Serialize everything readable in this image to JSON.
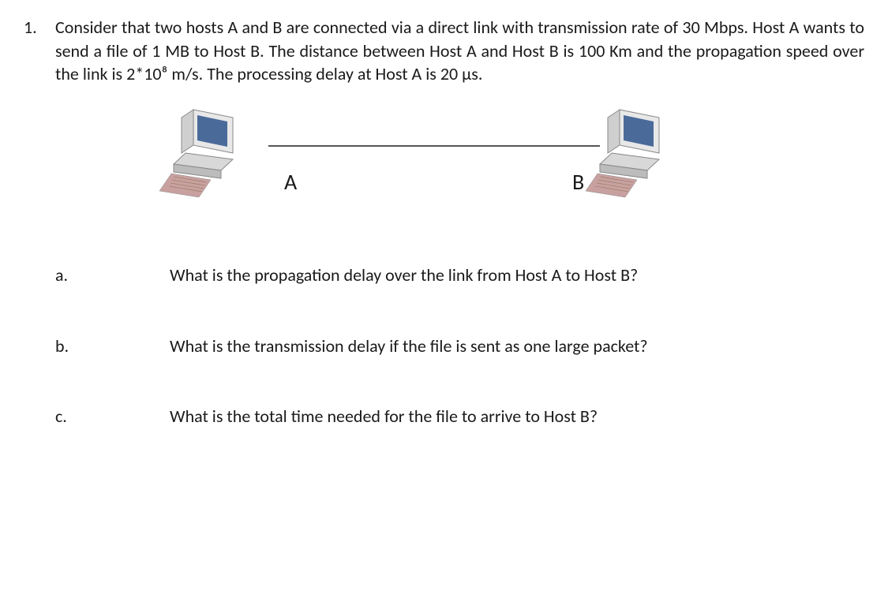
{
  "question_number": "1.",
  "intro": "Consider that two hosts A and B are connected via a direct link with transmission rate of 30 Mbps. Host A wants to send a file of 1 MB to Host B. The distance between Host A and Host B is 100 Km and the propagation speed over the link is 2*10⁸ m/s. The processing delay at Host A is 20 µs.",
  "diagram": {
    "label_a": "A",
    "label_b": "B"
  },
  "subquestions": [
    {
      "label": "a.",
      "text": "What is the propagation delay over the link from Host A to Host B?"
    },
    {
      "label": "b.",
      "text": "What is the transmission delay if the file is sent as one large packet?"
    },
    {
      "label": "c.",
      "text": "What is the total time needed for the file to arrive to Host B?"
    }
  ]
}
